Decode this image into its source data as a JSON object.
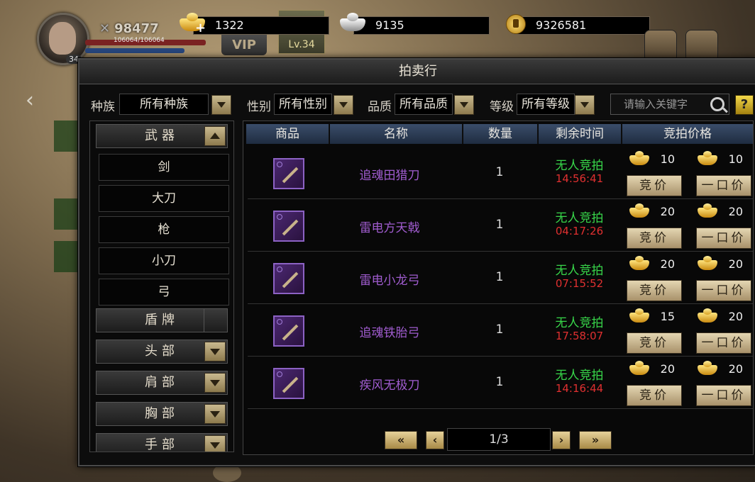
{
  "hud": {
    "power": "98477",
    "hp_text": "106064/106064",
    "level_badge": "34",
    "vip": "VIP",
    "level": "Lv.34",
    "gold": "1322",
    "silver": "9135",
    "coins": "9326581"
  },
  "window": {
    "title": "拍卖行",
    "close": "✕"
  },
  "filters": {
    "race_label": "种族",
    "race_value": "所有种族",
    "gender_label": "性别",
    "gender_value": "所有性别",
    "quality_label": "品质",
    "quality_value": "所有品质",
    "level_label": "等级",
    "level_value": "所有等级",
    "search_placeholder": "请输入关键字",
    "help": "?"
  },
  "categories": {
    "weapon": "武器",
    "sub_items": [
      "剑",
      "大刀",
      "枪",
      "小刀",
      "弓"
    ],
    "shield": "盾牌",
    "head": "头部",
    "shoulder": "肩部",
    "chest": "胸部",
    "hand": "手部"
  },
  "table": {
    "headers": [
      "商品",
      "名称",
      "数量",
      "剩余时间",
      "竞拍价格"
    ],
    "bid_button": "竞价",
    "buyout_button": "一口价",
    "rows": [
      {
        "name": "追魂田猎刀",
        "qty": "1",
        "status": "无人竞拍",
        "time": "14:56:41",
        "bid": "10",
        "buyout": "10"
      },
      {
        "name": "雷电方天戟",
        "qty": "1",
        "status": "无人竞拍",
        "time": "04:17:26",
        "bid": "20",
        "buyout": "20"
      },
      {
        "name": "雷电小龙弓",
        "qty": "1",
        "status": "无人竞拍",
        "time": "07:15:52",
        "bid": "20",
        "buyout": "20"
      },
      {
        "name": "追魂铁胎弓",
        "qty": "1",
        "status": "无人竞拍",
        "time": "17:58:07",
        "bid": "15",
        "buyout": "20"
      },
      {
        "name": "疾风无极刀",
        "qty": "1",
        "status": "无人竞拍",
        "time": "14:16:44",
        "bid": "20",
        "buyout": "20"
      }
    ]
  },
  "pager": {
    "first": "«",
    "prev": "‹",
    "page": "1/3",
    "next": "›",
    "last": "»"
  }
}
